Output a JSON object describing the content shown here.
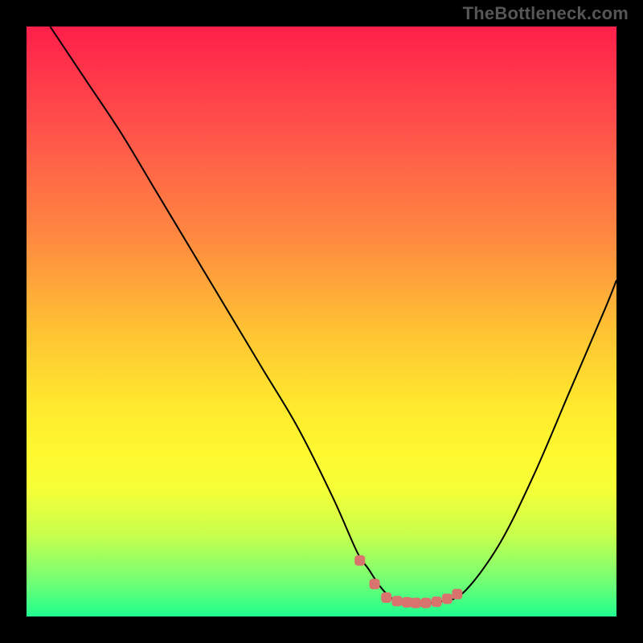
{
  "watermark": "TheBottleneck.com",
  "colors": {
    "page_bg": "#000000",
    "curve_stroke": "#000000",
    "marker_fill": "#d9736d",
    "gradient_top": "#ff1f4a",
    "gradient_bottom": "#1fff8f"
  },
  "chart_data": {
    "type": "line",
    "title": "",
    "xlabel": "",
    "ylabel": "",
    "xlim": [
      0,
      100
    ],
    "ylim": [
      0,
      100
    ],
    "grid": false,
    "legend": false,
    "series": [
      {
        "name": "curve",
        "x": [
          4,
          10,
          16,
          22,
          28,
          34,
          40,
          46,
          52,
          56,
          58,
          60,
          62,
          64,
          66,
          68,
          70,
          74,
          80,
          86,
          92,
          98,
          100
        ],
        "y": [
          100,
          91,
          82,
          72,
          62,
          52,
          42,
          32,
          20,
          11,
          8,
          5,
          3,
          2.5,
          2.3,
          2.3,
          2.5,
          4,
          12,
          24,
          38,
          52,
          57
        ]
      }
    ],
    "markers": {
      "name": "highlight",
      "shape": "rounded-square",
      "x": [
        56.5,
        59,
        61,
        62.8,
        64.5,
        66,
        67.7,
        69.5,
        71.3,
        73
      ],
      "y": [
        9.5,
        5.5,
        3.2,
        2.6,
        2.4,
        2.3,
        2.3,
        2.5,
        3.0,
        3.8
      ]
    }
  }
}
